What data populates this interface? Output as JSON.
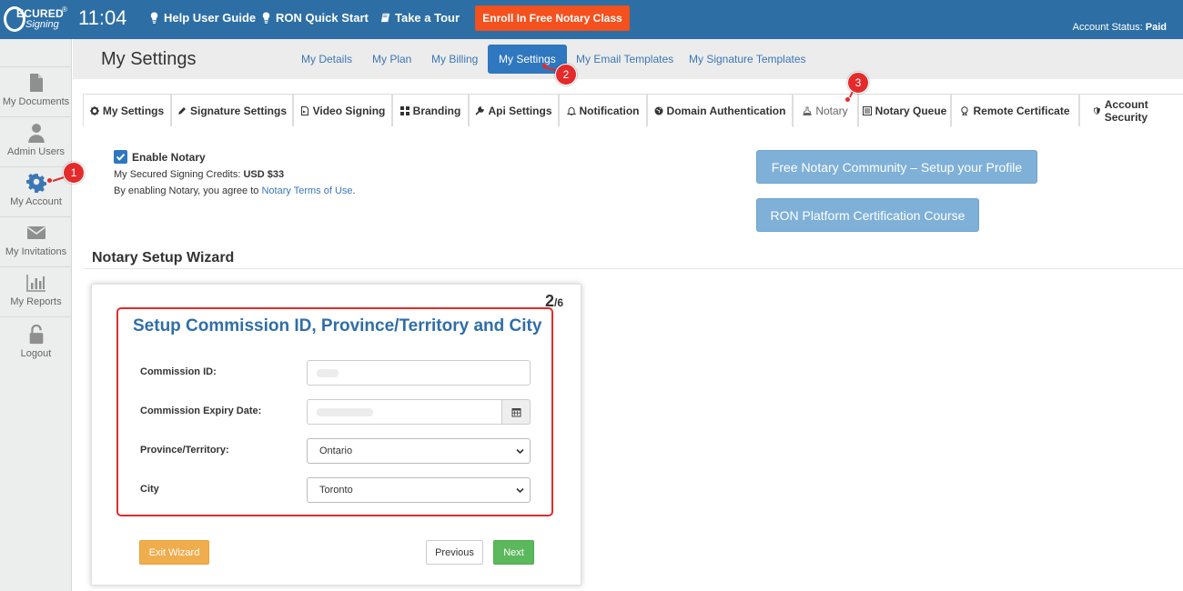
{
  "topbar": {
    "logo_word1": "ECURED",
    "logo_word2": "Signing",
    "logo_reg": "®",
    "clock": "11:04",
    "links": [
      {
        "label": "Help User Guide",
        "icon": "lightbulb-icon"
      },
      {
        "label": "RON Quick Start",
        "icon": "lightbulb-icon"
      },
      {
        "label": "Take a Tour",
        "icon": "book-icon"
      }
    ],
    "enroll_label": "Enroll In Free Notary Class",
    "account_status_label": "Account Status:",
    "account_status_value": "Paid"
  },
  "sidebar": {
    "items": [
      {
        "label": "My Documents",
        "icon": "document-icon"
      },
      {
        "label": "Admin Users",
        "icon": "user-icon"
      },
      {
        "label": "My Account",
        "icon": "gear-icon",
        "active": true
      },
      {
        "label": "My Invitations",
        "icon": "envelope-icon"
      },
      {
        "label": "My Reports",
        "icon": "bar-chart-icon"
      },
      {
        "label": "Logout",
        "icon": "unlock-icon"
      }
    ]
  },
  "header": {
    "title": "My Settings",
    "tabs": [
      "My Details",
      "My Plan",
      "My Billing",
      "My Settings",
      "My Email Templates",
      "My Signature Templates"
    ],
    "active_tab": "My Settings"
  },
  "subtabs": [
    {
      "label": "My Settings",
      "icon": "gear-icon"
    },
    {
      "label": "Signature Settings",
      "icon": "pen-icon"
    },
    {
      "label": "Video Signing",
      "icon": "video-file-icon"
    },
    {
      "label": "Branding",
      "icon": "grid-icon"
    },
    {
      "label": "Api Settings",
      "icon": "wrench-icon"
    },
    {
      "label": "Notification",
      "icon": "bell-icon"
    },
    {
      "label": "Domain Authentication",
      "icon": "globe-icon"
    },
    {
      "label": "Notary",
      "icon": "stamp-icon",
      "active": true
    },
    {
      "label": "Notary Queue",
      "icon": "list-icon"
    },
    {
      "label": "Remote Certificate",
      "icon": "certificate-icon"
    },
    {
      "label": "Account Security",
      "icon": "shield-icon"
    }
  ],
  "notary": {
    "enable_label": "Enable Notary",
    "enabled": true,
    "credits_label": "My Secured Signing Credits:",
    "credits_value": "USD $33",
    "terms_prefix": "By enabling Notary, you agree to",
    "terms_link": "Notary Terms of Use",
    "terms_suffix": ".",
    "community_button": "Free Notary Community – Setup your Profile",
    "course_button": "RON Platform Certification Course"
  },
  "wizard": {
    "section_title": "Notary Setup Wizard",
    "step_current": "2",
    "step_total": "/6",
    "card_title": "Setup Commission ID, Province/Territory and City",
    "fields": {
      "commission_id_label": "Commission ID:",
      "expiry_label": "Commission Expiry Date:",
      "province_label": "Province/Territory:",
      "province_value": "Ontario",
      "city_label": "City",
      "city_value": "Toronto"
    },
    "exit_label": "Exit Wizard",
    "previous_label": "Previous",
    "next_label": "Next"
  },
  "annotations": [
    "1",
    "2",
    "3"
  ],
  "colors": {
    "topbar": "#2d6fa5",
    "enroll": "#f4511e",
    "primary": "#2f77bf",
    "link": "#3b77b5",
    "light_button": "#7fb0d8",
    "exit": "#f0ad4e",
    "next": "#5cb85c",
    "annotation": "#e32b2b"
  }
}
